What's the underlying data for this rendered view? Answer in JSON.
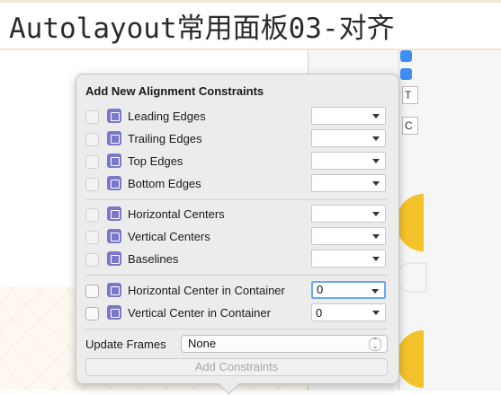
{
  "slide": {
    "title": "Autolayout常用面板03-对齐"
  },
  "editor": {
    "field1": "T",
    "field2": "C"
  },
  "popover": {
    "title": "Add New Alignment Constraints",
    "rows": [
      {
        "label": "Leading Edges",
        "value": "",
        "icon": "leading-edges-icon"
      },
      {
        "label": "Trailing Edges",
        "value": "",
        "icon": "trailing-edges-icon"
      },
      {
        "label": "Top Edges",
        "value": "",
        "icon": "top-edges-icon"
      },
      {
        "label": "Bottom Edges",
        "value": "",
        "icon": "bottom-edges-icon"
      },
      {
        "label": "Horizontal Centers",
        "value": "",
        "icon": "horizontal-centers-icon"
      },
      {
        "label": "Vertical Centers",
        "value": "",
        "icon": "vertical-centers-icon"
      },
      {
        "label": "Baselines",
        "value": "",
        "icon": "baselines-icon"
      },
      {
        "label": "Horizontal Center in Container",
        "value": "0",
        "icon": "horizontal-center-container-icon"
      },
      {
        "label": "Vertical Center in Container",
        "value": "0",
        "icon": "vertical-center-container-icon"
      }
    ],
    "update_frames_label": "Update Frames",
    "update_frames_value": "None",
    "add_button": "Add Constraints",
    "accent": "#6aa8f4",
    "icon_color": "#7a78c8"
  }
}
